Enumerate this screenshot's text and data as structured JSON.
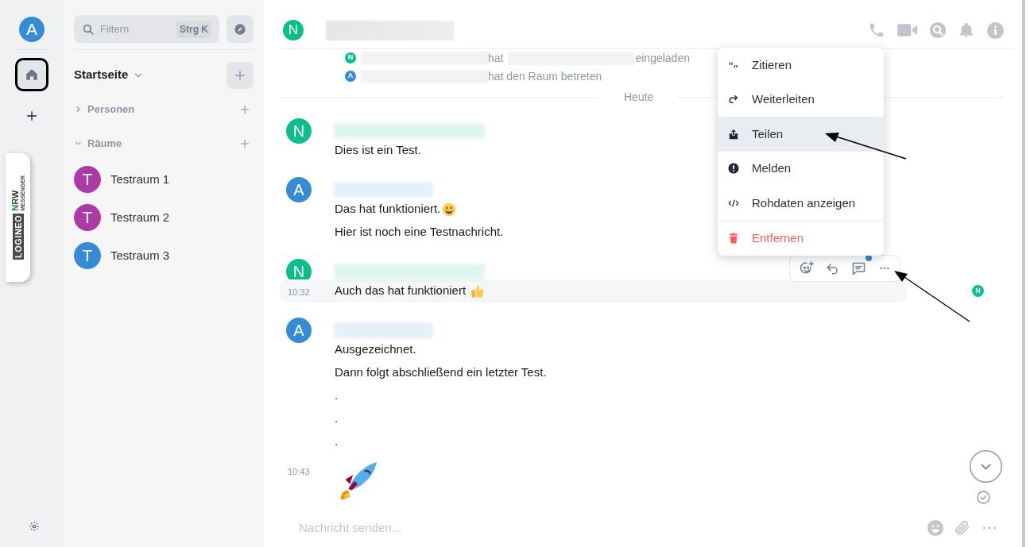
{
  "space_bar": {
    "user_avatar": "A",
    "home": {
      "selected": true
    },
    "logo": {
      "word": "LOGINEO",
      "region": "NRW",
      "product": "MESSENGER"
    }
  },
  "room_list": {
    "filter": {
      "placeholder": "Filtern",
      "shortcut": "Strg K"
    },
    "heading": "Startseite",
    "sections": [
      {
        "label": "Personen",
        "expanded": false
      },
      {
        "label": "Räume",
        "expanded": true,
        "rooms": [
          {
            "avatar": "T",
            "name": "Testraum 1",
            "color": "#ac3ba8"
          },
          {
            "avatar": "T",
            "name": "Testraum 2",
            "color": "#ac3ba8"
          },
          {
            "avatar": "T",
            "name": "Testraum 3",
            "color": "#368bd6"
          }
        ]
      }
    ]
  },
  "room_header": {
    "avatar": "N",
    "color": "#0dbd8b"
  },
  "timeline": [
    {
      "kind": "event",
      "avatar": "N",
      "color": "#0dbd8b",
      "parts": [
        "hat",
        "eingeladen"
      ]
    },
    {
      "kind": "event",
      "avatar": "A",
      "color": "#368bd6",
      "parts": [
        "hat den Raum betreten"
      ]
    },
    {
      "kind": "date",
      "label": "Heute"
    },
    {
      "kind": "message",
      "avatar": "N",
      "color": "#0dbd8b",
      "lines": [
        {
          "kind": "text",
          "text": "Dies ist ein Test."
        }
      ]
    },
    {
      "kind": "message",
      "avatar": "A",
      "color": "#368bd6",
      "lines": [
        {
          "kind": "with_smile",
          "text": "Das hat funktioniert."
        },
        {
          "kind": "text",
          "text": "Hier ist noch eine Testnachricht."
        }
      ]
    },
    {
      "kind": "message",
      "avatar": "N",
      "color": "#0dbd8b",
      "lines": [
        {
          "kind": "with_thumbs_up",
          "text": "Auch das hat funktioniert",
          "time": "10:32",
          "highlighted": true,
          "receipt": "N"
        }
      ]
    },
    {
      "kind": "message",
      "avatar": "A",
      "color": "#368bd6",
      "lines": [
        {
          "kind": "text",
          "text": "Ausgezeichnet."
        },
        {
          "kind": "text",
          "text": "Dann folgt abschließend ein letzter Test."
        },
        {
          "kind": "text",
          "text": "."
        },
        {
          "kind": "text",
          "text": "."
        },
        {
          "kind": "text",
          "text": "."
        },
        {
          "kind": "rocket",
          "time": "10:43"
        }
      ]
    }
  ],
  "context_menu": [
    {
      "kind": "quote",
      "label": "Zitieren",
      "selected": false
    },
    {
      "kind": "forward",
      "label": "Weiterleiten",
      "selected": false
    },
    {
      "kind": "share",
      "label": "Teilen",
      "selected": true
    },
    {
      "kind": "report",
      "label": "Melden",
      "selected": false
    },
    {
      "kind": "source",
      "label": "Rohdaten anzeigen",
      "selected": false
    },
    {
      "kind": "remove",
      "label": "Entfernen",
      "selected": false
    }
  ],
  "composer": {
    "placeholder": "Nachricht senden..."
  }
}
